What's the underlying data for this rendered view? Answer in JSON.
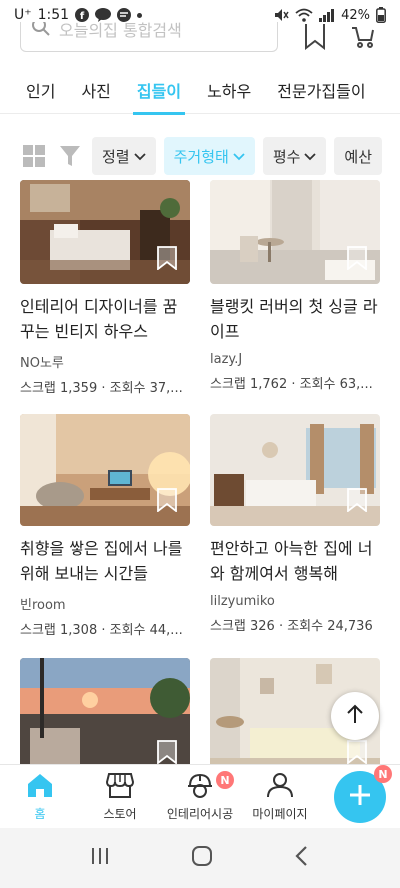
{
  "status": {
    "carrier": "U⁺",
    "time": "1:51",
    "battery": "42%"
  },
  "search": {
    "placeholder": "오늘의집 통합검색"
  },
  "tabs": [
    {
      "label": "인기"
    },
    {
      "label": "사진"
    },
    {
      "label": "집들이",
      "active": true
    },
    {
      "label": "노하우"
    },
    {
      "label": "전문가집들이"
    }
  ],
  "filters": [
    {
      "label": "정렬",
      "active": false
    },
    {
      "label": "주거형태",
      "active": true
    },
    {
      "label": "평수",
      "active": false
    },
    {
      "label": "예산",
      "active": false
    }
  ],
  "cards": [
    {
      "title": "인테리어 디자이너를 꿈꾸는 빈티지 하우스",
      "author": "NO노루",
      "stats": "스크랩 1,359 · 조회수 37,..."
    },
    {
      "title": "블랭킷 러버의 첫 싱글 라이프",
      "author": "lazy.J",
      "stats": "스크랩 1,762 · 조회수 63,..."
    },
    {
      "title": "취향을 쌓은 집에서 나를 위해 보내는 시간들",
      "author": "빈room",
      "stats": "스크랩 1,308 · 조회수 44,..."
    },
    {
      "title": "편안하고 아늑한 집에 너와 함께여서 행복해",
      "author": "lilzyumiko",
      "stats": "스크랩 326 · 조회수 24,736"
    },
    {
      "title": "",
      "author": "",
      "stats": ""
    },
    {
      "title": "",
      "author": "",
      "stats": ""
    }
  ],
  "bottom_nav": [
    {
      "label": "홈",
      "icon": "home-icon",
      "active": true
    },
    {
      "label": "스토어",
      "icon": "store-icon"
    },
    {
      "label": "인테리어시공",
      "icon": "construction-icon",
      "badge": "N"
    },
    {
      "label": "마이페이지",
      "icon": "person-icon"
    }
  ],
  "fab_badge": "N",
  "colors": {
    "accent": "#35c5f0",
    "badge": "#ff7777"
  }
}
